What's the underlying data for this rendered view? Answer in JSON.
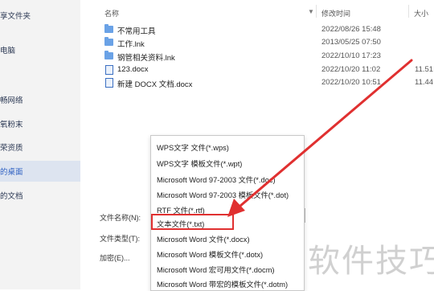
{
  "sidebar": {
    "items": [
      {
        "label": "享文件夹"
      },
      {
        "label": "电脑"
      },
      {
        "label": "畅网络"
      },
      {
        "label": "氧粉末"
      },
      {
        "label": "荣资质"
      },
      {
        "label": "的桌面"
      },
      {
        "label": "的文档"
      }
    ]
  },
  "columns": {
    "name": "名称",
    "modified": "修改时间",
    "size": "大小"
  },
  "files": [
    {
      "name": "不常用工具",
      "date": "2022/08/26 15:48",
      "size": "",
      "icon": "folder-icon"
    },
    {
      "name": "工作.lnk",
      "date": "2013/05/25 07:50",
      "size": "",
      "icon": "folder-icon"
    },
    {
      "name": "钢管相关资料.lnk",
      "date": "2022/10/10 17:23",
      "size": "",
      "icon": "folder-icon"
    },
    {
      "name": "123.docx",
      "date": "2022/10/20 11:02",
      "size": "11.51",
      "icon": "document-icon"
    },
    {
      "name": "新建 DOCX 文档.docx",
      "date": "2022/10/20 10:51",
      "size": "11.44",
      "icon": "document-icon"
    }
  ],
  "form": {
    "filename_label": "文件名称(N):",
    "filetype_label": "文件类型(T):",
    "encrypt_label": "加密(E)..."
  },
  "file_types": [
    {
      "label": "WPS文字 文件(*.wps)"
    },
    {
      "label": "WPS文字 模板文件(*.wpt)"
    },
    {
      "label": "Microsoft Word 97-2003 文件(*.doc)"
    },
    {
      "label": "Microsoft Word 97-2003 模板文件(*.dot)"
    },
    {
      "label": "RTF 文件(*.rtf)"
    },
    {
      "label": "文本文件(*.txt)"
    },
    {
      "label": "Microsoft Word 文件(*.docx)"
    },
    {
      "label": "Microsoft Word 模板文件(*.dotx)"
    },
    {
      "label": "Microsoft Word 宏可用文件(*.docm)"
    },
    {
      "label": "Microsoft Word 带宏的模板文件(*.dotm)"
    }
  ],
  "selected_file_type_index": 5,
  "watermark": "软件技巧",
  "colors": {
    "highlight": "#e03030",
    "selected_nav": "#2f61c2"
  }
}
